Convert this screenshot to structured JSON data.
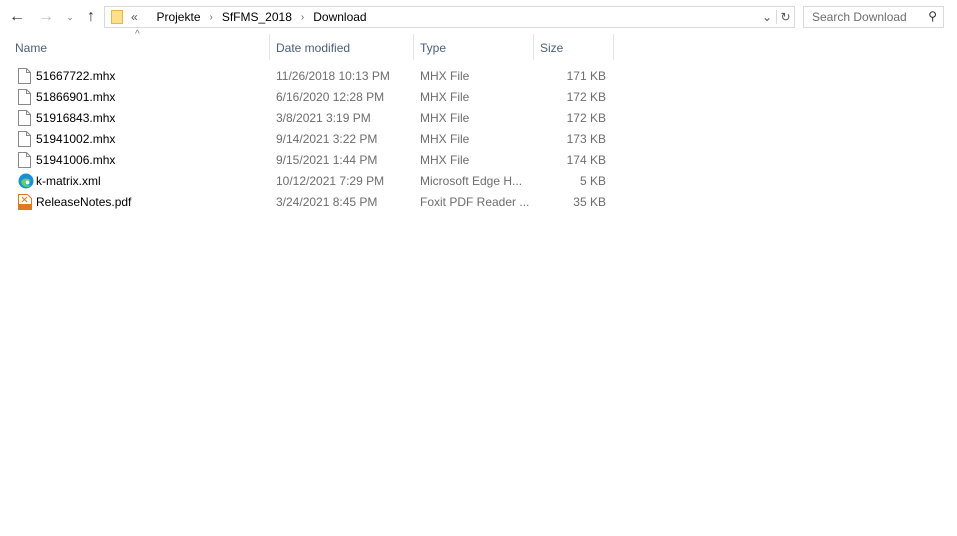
{
  "breadcrumb": {
    "overflow": "«",
    "items": [
      "Projekte",
      "SfFMS_2018",
      "Download"
    ]
  },
  "search": {
    "placeholder": "Search Download"
  },
  "columns": {
    "name": "Name",
    "date": "Date modified",
    "type": "Type",
    "size": "Size"
  },
  "files": [
    {
      "name": "51667722.mhx",
      "date": "11/26/2018 10:13 PM",
      "type": "MHX File",
      "size": "171 KB",
      "icon": "file-icon"
    },
    {
      "name": "51866901.mhx",
      "date": "6/16/2020 12:28 PM",
      "type": "MHX File",
      "size": "172 KB",
      "icon": "file-icon"
    },
    {
      "name": "51916843.mhx",
      "date": "3/8/2021 3:19 PM",
      "type": "MHX File",
      "size": "172 KB",
      "icon": "file-icon"
    },
    {
      "name": "51941002.mhx",
      "date": "9/14/2021 3:22 PM",
      "type": "MHX File",
      "size": "173 KB",
      "icon": "file-icon"
    },
    {
      "name": "51941006.mhx",
      "date": "9/15/2021 1:44 PM",
      "type": "MHX File",
      "size": "174 KB",
      "icon": "file-icon"
    },
    {
      "name": "k-matrix.xml",
      "date": "10/12/2021 7:29 PM",
      "type": "Microsoft Edge H...",
      "size": "5 KB",
      "icon": "edge-icon"
    },
    {
      "name": "ReleaseNotes.pdf",
      "date": "3/24/2021 8:45 PM",
      "type": "Foxit PDF Reader ...",
      "size": "35 KB",
      "icon": "pdf-icon"
    }
  ]
}
